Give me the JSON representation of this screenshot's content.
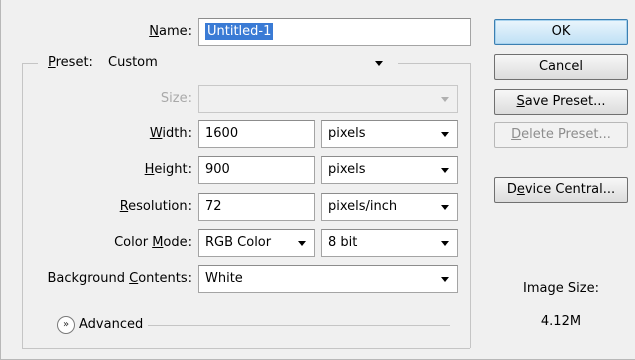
{
  "form": {
    "name_label_access": "N",
    "name_label_rest": "ame:",
    "name_value": "Untitled-1",
    "preset_label_access": "P",
    "preset_label_rest": "reset:",
    "preset_value": "Custom",
    "size_label": "Size:",
    "size_value": "",
    "width_label_access": "W",
    "width_label_rest": "idth:",
    "width_value": "1600",
    "width_unit": "pixels",
    "height_label_access": "H",
    "height_label_rest": "eight:",
    "height_value": "900",
    "height_unit": "pixels",
    "resolution_label_access": "R",
    "resolution_label_rest": "esolution:",
    "resolution_value": "72",
    "resolution_unit": "pixels/inch",
    "color_mode_label_pre": "Color ",
    "color_mode_label_access": "M",
    "color_mode_label_rest": "ode:",
    "color_mode_value": "RGB Color",
    "bit_depth_value": "8 bit",
    "background_label_pre": "Background ",
    "background_label_access": "C",
    "background_label_rest": "ontents:",
    "background_value": "White",
    "advanced_label": "Advanced"
  },
  "buttons": {
    "ok": "OK",
    "cancel": "Cancel",
    "save_preset_access": "S",
    "save_preset_rest": "ave Preset...",
    "delete_preset_access": "D",
    "delete_preset_rest": "elete Preset...",
    "device_central_pre": "D",
    "device_central_access": "e",
    "device_central_rest": "vice Central..."
  },
  "image_size": {
    "label": "Image Size:",
    "value": "4.12M"
  },
  "icons": {
    "advanced_toggle": "chevron-double-down-icon",
    "dropdown": "caret-down-icon"
  }
}
